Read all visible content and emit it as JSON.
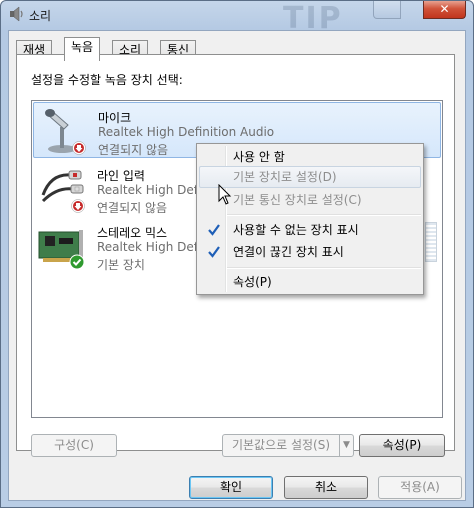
{
  "window": {
    "title": "소리",
    "watermark": "TIP",
    "close_glyph": "✕"
  },
  "tabs": [
    {
      "label": "재생",
      "active": false
    },
    {
      "label": "녹음",
      "active": true
    },
    {
      "label": "소리",
      "active": false
    },
    {
      "label": "통신",
      "active": false
    }
  ],
  "panel": {
    "caption": "설정을 수정할 녹음 장치 선택:"
  },
  "devices": [
    {
      "name": "마이크",
      "driver": "Realtek High Definition Audio",
      "status": "연결되지 않음",
      "icon": "microphone-icon",
      "badge": "disconnected-badge-icon"
    },
    {
      "name": "라인 입력",
      "driver": "Realtek High Definition Audio",
      "status": "연결되지 않음",
      "icon": "line-in-cable-icon",
      "badge": "disconnected-badge-icon"
    },
    {
      "name": "스테레오 믹스",
      "driver": "Realtek High Definition Audio",
      "status": "기본 장치",
      "icon": "sound-card-icon",
      "badge": "default-check-badge-icon"
    }
  ],
  "context_menu": {
    "items": [
      {
        "label": "사용 안 함",
        "enabled": true,
        "checked": false
      },
      {
        "label": "기본 장치로 설정(D)",
        "enabled": false,
        "checked": false
      },
      {
        "label": "기본 통신 장치로 설정(C)",
        "enabled": false,
        "checked": false
      },
      {
        "label": "사용할 수 없는 장치 표시",
        "enabled": true,
        "checked": true
      },
      {
        "label": "연결이 끊긴 장치 표시",
        "enabled": true,
        "checked": true
      },
      {
        "label": "속성(P)",
        "enabled": true,
        "checked": false
      }
    ]
  },
  "panel_buttons": {
    "configure": "구성(C)",
    "set_default": "기본값으로 설정(S)",
    "properties": "속성(P)"
  },
  "dialog_buttons": {
    "ok": "확인",
    "cancel": "취소",
    "apply": "적용(A)"
  },
  "colors": {
    "selection": "#d5e7fb",
    "close_button": "#c1351d",
    "check_blue": "#1f5fb7",
    "disconnected_red": "#c62b2b",
    "default_green": "#2f9a2f"
  }
}
